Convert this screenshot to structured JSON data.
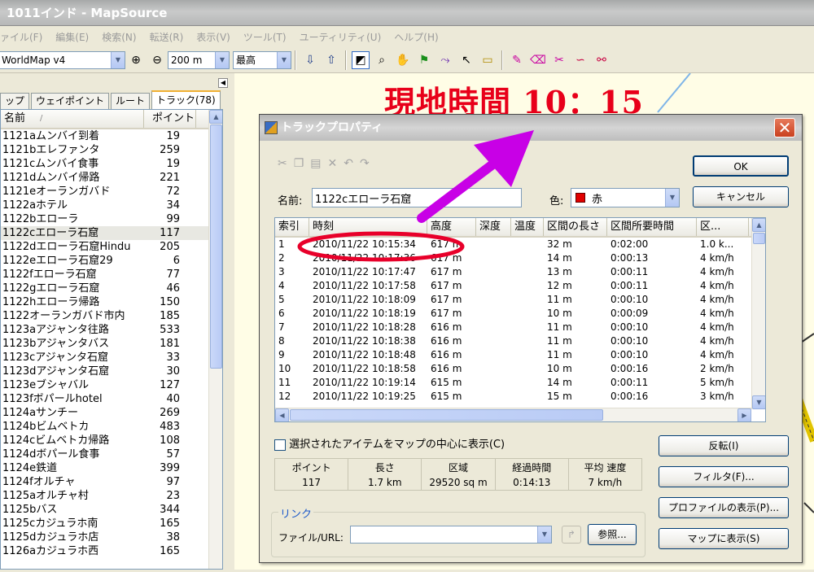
{
  "window": {
    "title": "1011インド - MapSource"
  },
  "menu": [
    "ァイル(F)",
    "編集(E)",
    "検索(N)",
    "転送(R)",
    "表示(V)",
    "ツール(T)",
    "ユーティリティ(U)",
    "ヘルプ(H)"
  ],
  "toolbar": {
    "map_product": "WorldMap v4",
    "zoom": "200 m",
    "detail": "最高"
  },
  "left_tabs": [
    "ップ",
    "ウェイポイント",
    "ルート",
    "トラック(78)"
  ],
  "track_list": {
    "headers": {
      "name": "名前",
      "sort_mark": "/",
      "points": "ポイント"
    },
    "rows": [
      {
        "name": "1121aムンバイ到着",
        "points": "19"
      },
      {
        "name": "1121bエレファンタ",
        "points": "259"
      },
      {
        "name": "1121cムンバイ食事",
        "points": "19"
      },
      {
        "name": "1121dムンバイ帰路",
        "points": "221"
      },
      {
        "name": "1121eオーランガバド",
        "points": "72"
      },
      {
        "name": "1122aホテル",
        "points": "34"
      },
      {
        "name": "1122bエローラ",
        "points": "99"
      },
      {
        "name": "1122cエローラ石窟",
        "points": "117"
      },
      {
        "name": "1122dエローラ石窟Hindu",
        "points": "205"
      },
      {
        "name": "1122eエローラ石窟29",
        "points": "6"
      },
      {
        "name": "1122fエローラ石窟",
        "points": "77"
      },
      {
        "name": "1122gエローラ石窟",
        "points": "46"
      },
      {
        "name": "1122hエローラ帰路",
        "points": "150"
      },
      {
        "name": "1122オーランガバド市内",
        "points": "185"
      },
      {
        "name": "1123aアジャンタ往路",
        "points": "533"
      },
      {
        "name": "1123bアジャンタバス",
        "points": "181"
      },
      {
        "name": "1123cアジャンタ石窟",
        "points": "33"
      },
      {
        "name": "1123dアジャンタ石窟",
        "points": "30"
      },
      {
        "name": "1123eブシャバル",
        "points": "127"
      },
      {
        "name": "1123fボパールhotel",
        "points": "40"
      },
      {
        "name": "1124aサンチー",
        "points": "269"
      },
      {
        "name": "1124bビムベトカ",
        "points": "483"
      },
      {
        "name": "1124cビムベトカ帰路",
        "points": "108"
      },
      {
        "name": "1124dボパール食事",
        "points": "57"
      },
      {
        "name": "1124e鉄道",
        "points": "399"
      },
      {
        "name": "1124fオルチャ",
        "points": "97"
      },
      {
        "name": "1125aオルチャ村",
        "points": "23"
      },
      {
        "name": "1125bバス",
        "points": "344"
      },
      {
        "name": "1125cカジュラホ南",
        "points": "165"
      },
      {
        "name": "1125dカジュラホ店",
        "points": "38"
      },
      {
        "name": "1126aカジュラホ西",
        "points": "165"
      }
    ],
    "selected_index": 7
  },
  "annotation": {
    "text": "現地時間 10：15",
    "color": "#e8001a",
    "arrow_color": "#c800e6",
    "ellipse_color": "#e8002a"
  },
  "dialog": {
    "title": "トラックプロパティ",
    "close_glyph": "✕",
    "name_label": "名前:",
    "name_value": "1122cエローラ石窟",
    "color_label": "色:",
    "color_value": "赤",
    "color_swatch": "#e00000",
    "ok": "OK",
    "cancel": "キャンセル",
    "columns": [
      "索引",
      "時刻",
      "高度",
      "深度",
      "温度",
      "区間の長さ",
      "区間所要時間",
      "区..."
    ],
    "points": [
      {
        "idx": "1",
        "time": "2010/11/22 10:15:34",
        "alt": "617 m",
        "depth": "",
        "temp": "",
        "len": "32 m",
        "dur": "0:02:00",
        "spd": "1.0 k..."
      },
      {
        "idx": "2",
        "time": "2010/11/22 10:17:36",
        "alt": "617 m",
        "depth": "",
        "temp": "",
        "len": "14 m",
        "dur": "0:00:13",
        "spd": "4 km/h"
      },
      {
        "idx": "3",
        "time": "2010/11/22 10:17:47",
        "alt": "617 m",
        "depth": "",
        "temp": "",
        "len": "13 m",
        "dur": "0:00:11",
        "spd": "4 km/h"
      },
      {
        "idx": "4",
        "time": "2010/11/22 10:17:58",
        "alt": "617 m",
        "depth": "",
        "temp": "",
        "len": "12 m",
        "dur": "0:00:11",
        "spd": "4 km/h"
      },
      {
        "idx": "5",
        "time": "2010/11/22 10:18:09",
        "alt": "617 m",
        "depth": "",
        "temp": "",
        "len": "11 m",
        "dur": "0:00:10",
        "spd": "4 km/h"
      },
      {
        "idx": "6",
        "time": "2010/11/22 10:18:19",
        "alt": "617 m",
        "depth": "",
        "temp": "",
        "len": "10 m",
        "dur": "0:00:09",
        "spd": "4 km/h"
      },
      {
        "idx": "7",
        "time": "2010/11/22 10:18:28",
        "alt": "616 m",
        "depth": "",
        "temp": "",
        "len": "11 m",
        "dur": "0:00:10",
        "spd": "4 km/h"
      },
      {
        "idx": "8",
        "time": "2010/11/22 10:18:38",
        "alt": "616 m",
        "depth": "",
        "temp": "",
        "len": "11 m",
        "dur": "0:00:10",
        "spd": "4 km/h"
      },
      {
        "idx": "9",
        "time": "2010/11/22 10:18:48",
        "alt": "616 m",
        "depth": "",
        "temp": "",
        "len": "11 m",
        "dur": "0:00:10",
        "spd": "4 km/h"
      },
      {
        "idx": "10",
        "time": "2010/11/22 10:18:58",
        "alt": "616 m",
        "depth": "",
        "temp": "",
        "len": "10 m",
        "dur": "0:00:16",
        "spd": "2 km/h"
      },
      {
        "idx": "11",
        "time": "2010/11/22 10:19:14",
        "alt": "615 m",
        "depth": "",
        "temp": "",
        "len": "14 m",
        "dur": "0:00:11",
        "spd": "5 km/h"
      },
      {
        "idx": "12",
        "time": "2010/11/22 10:19:25",
        "alt": "615 m",
        "depth": "",
        "temp": "",
        "len": "15 m",
        "dur": "0:00:16",
        "spd": "3 km/h"
      }
    ],
    "center_checkbox": "選択されたアイテムをマップの中心に表示(C)",
    "reverse": "反転(I)",
    "filter": "フィルタ(F)...",
    "show_profile": "プロファイルの表示(P)...",
    "show_on_map": "マップに表示(S)",
    "stats": [
      {
        "label": "ポイント",
        "value": "117"
      },
      {
        "label": "長さ",
        "value": "1.7 km"
      },
      {
        "label": "区域",
        "value": "29520 sq m"
      },
      {
        "label": "経過時間",
        "value": "0:14:13"
      },
      {
        "label": "平均 速度",
        "value": "7 km/h"
      }
    ],
    "link_group": "リンク",
    "file_url_label": "ファイル/URL:",
    "file_url_value": "",
    "browse": "参照..."
  }
}
